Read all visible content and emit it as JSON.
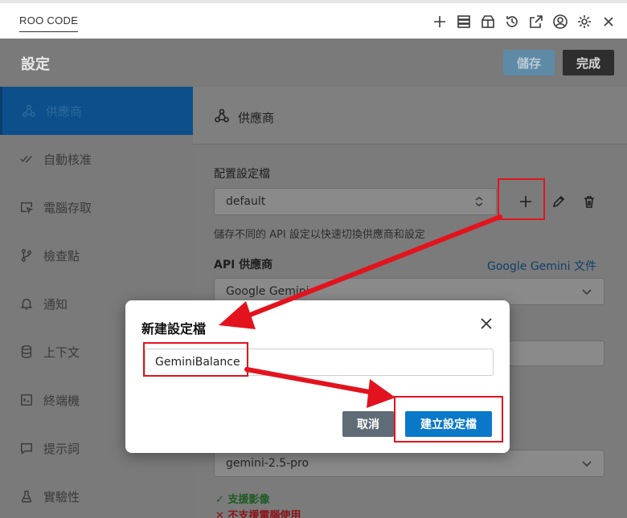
{
  "app": {
    "title": "ROO CODE"
  },
  "top_icons": [
    "plus-icon",
    "server-icon",
    "marketplace-icon",
    "history-icon",
    "popout-icon",
    "account-icon",
    "settings-icon",
    "close-icon"
  ],
  "header": {
    "title": "設定",
    "save_label": "儲存",
    "done_label": "完成"
  },
  "sidebar": {
    "items": [
      {
        "label": "供應商",
        "icon": "webhook-icon",
        "active": true
      },
      {
        "label": "自動核准",
        "icon": "check-all-icon"
      },
      {
        "label": "電腦存取",
        "icon": "cursor-window-icon"
      },
      {
        "label": "檢查點",
        "icon": "git-branch-icon"
      },
      {
        "label": "通知",
        "icon": "bell-icon"
      },
      {
        "label": "上下文",
        "icon": "database-icon"
      },
      {
        "label": "終端機",
        "icon": "terminal-icon"
      },
      {
        "label": "提示詞",
        "icon": "comment-icon"
      },
      {
        "label": "實驗性",
        "icon": "beaker-icon"
      }
    ]
  },
  "main": {
    "section_title": "供應商",
    "config_label": "配置設定檔",
    "config_value": "default",
    "config_hint": "儲存不同的 API 設定以快速切換供應商和設定",
    "api_provider_label": "API 供應商",
    "api_provider_link": "Google Gemini 文件",
    "api_provider_value": "Google Gemini",
    "model_value": "gemini-2.5-pro",
    "supports_images": "✓ 支援影像",
    "no_computer_use": "✕ 不支援電腦使用"
  },
  "dialog": {
    "title": "新建設定檔",
    "input_value": "GeminiBalance",
    "cancel_label": "取消",
    "create_label": "建立設定檔"
  },
  "colors": {
    "accent": "#0a78c8",
    "annotation": "#e3131e",
    "success": "#1c7a2a",
    "error": "#b3161d"
  }
}
